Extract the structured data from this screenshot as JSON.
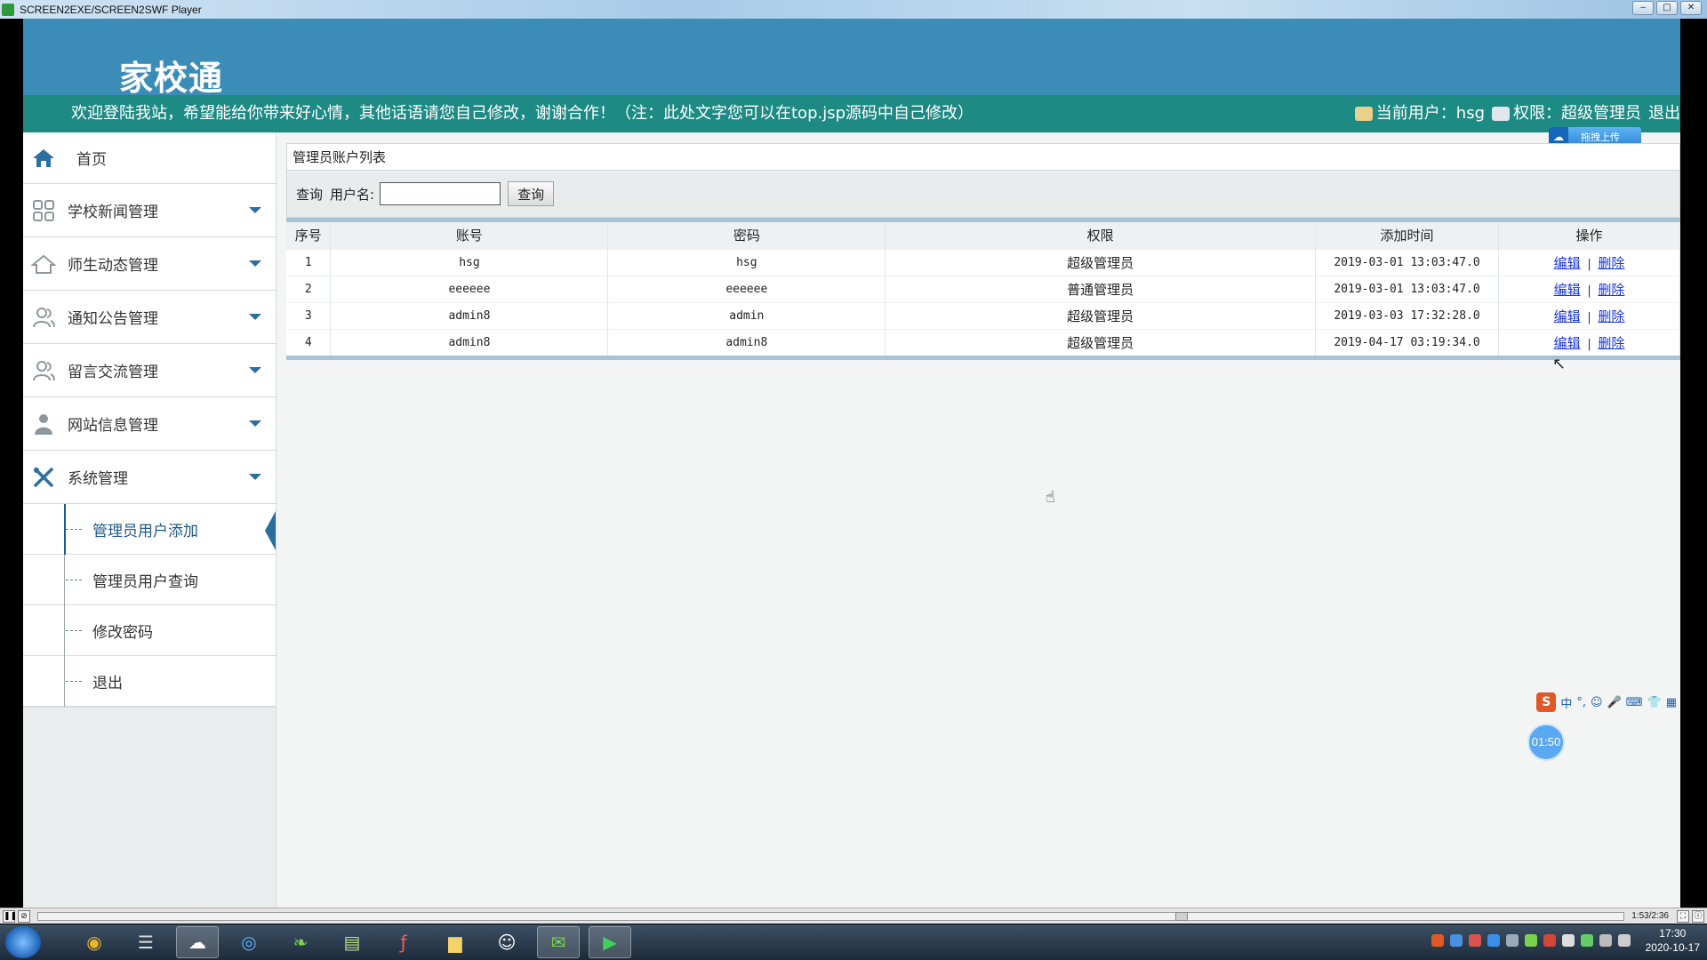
{
  "window": {
    "title": "SCREEN2EXE/SCREEN2SWF Player",
    "controls": [
      "‒",
      "□",
      "✕"
    ]
  },
  "header": {
    "logo": "家校通",
    "welcome": "欢迎登陆我站，希望能给你带来好心情，其他话语请您自己修改，谢谢合作！（注：此处文字您可以在top.jsp源码中自己修改）",
    "current_user": "当前用户：hsg",
    "permission": "权限：超级管理员",
    "logout": "退出",
    "upload_chip": "拖拽上传"
  },
  "sidebar": {
    "home": "首页",
    "items": [
      {
        "label": "学校新闻管理",
        "icon": "grid-icon"
      },
      {
        "label": "师生动态管理",
        "icon": "house-icon"
      },
      {
        "label": "通知公告管理",
        "icon": "users-icon"
      },
      {
        "label": "留言交流管理",
        "icon": "users-icon"
      },
      {
        "label": "网站信息管理",
        "icon": "person-icon"
      },
      {
        "label": "系统管理",
        "icon": "tools-icon"
      }
    ],
    "sub_items": [
      "管理员用户添加",
      "管理员用户查询",
      "修改密码",
      "退出"
    ],
    "active_sub": 0
  },
  "main": {
    "panel_title": "管理员账户列表",
    "search": {
      "prefix": "查询",
      "label": "用户名:",
      "value": "",
      "button": "查询"
    },
    "columns": [
      "序号",
      "账号",
      "密码",
      "权限",
      "添加时间",
      "操作"
    ],
    "rows": [
      {
        "id": "1",
        "account": "hsg",
        "password": "hsg",
        "role": "超级管理员",
        "time": "2019-03-01 13:03:47.0"
      },
      {
        "id": "2",
        "account": "eeeeee",
        "password": "eeeeee",
        "role": "普通管理员",
        "time": "2019-03-01 13:03:47.0"
      },
      {
        "id": "3",
        "account": "admin8",
        "password": "admin",
        "role": "超级管理员",
        "time": "2019-03-03 17:32:28.0"
      },
      {
        "id": "4",
        "account": "admin8",
        "password": "admin8",
        "role": "超级管理员",
        "time": "2019-04-17 03:19:34.0"
      }
    ],
    "ops": {
      "edit": "编辑",
      "sep": "|",
      "delete": "删除"
    }
  },
  "overlay": {
    "timer": "01:50",
    "ime_lang": "中"
  },
  "player": {
    "time": "1:53/2:36",
    "progress": 0.723
  },
  "taskbar": {
    "time": "17:30",
    "date": "2020-10-17"
  },
  "colors": {
    "header": "#3b8db8",
    "notice_bar": "#1e8a84",
    "link": "#1a35d4",
    "active_accent": "#2a6ea0"
  }
}
